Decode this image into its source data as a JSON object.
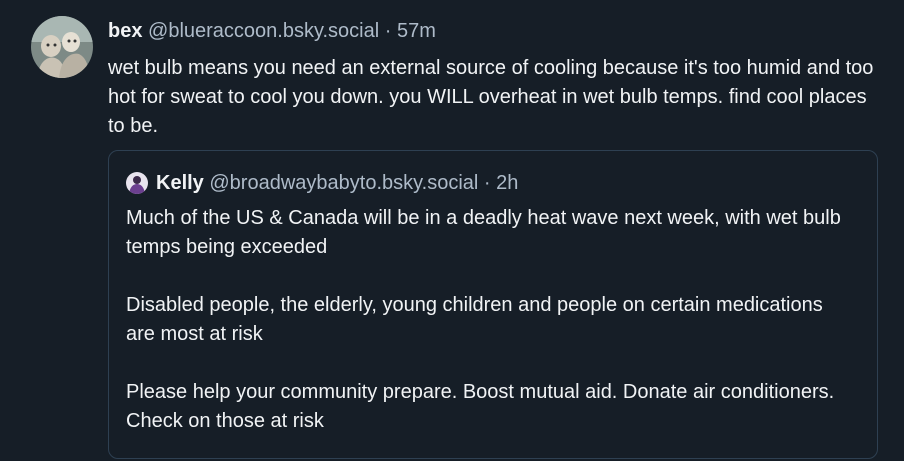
{
  "post": {
    "author_name": "bex",
    "author_handle": "@blueraccoon.bsky.social",
    "separator": "·",
    "time": "57m",
    "text": "wet bulb means you need an external source of cooling because it's too humid and too hot for sweat to cool you down. you WILL overheat in wet bulb temps. find cool places to be."
  },
  "quote": {
    "author_name": "Kelly",
    "author_handle": "@broadwaybabyto.bsky.social",
    "separator": "·",
    "time": "2h",
    "paragraphs": [
      "Much of the US & Canada will be in a deadly heat wave next week, with wet bulb temps being exceeded",
      "Disabled people, the elderly, young children and people on certain medications are most at risk",
      "Please help your community prepare. Boost mutual aid. Donate air conditioners. Check on those at risk"
    ]
  }
}
